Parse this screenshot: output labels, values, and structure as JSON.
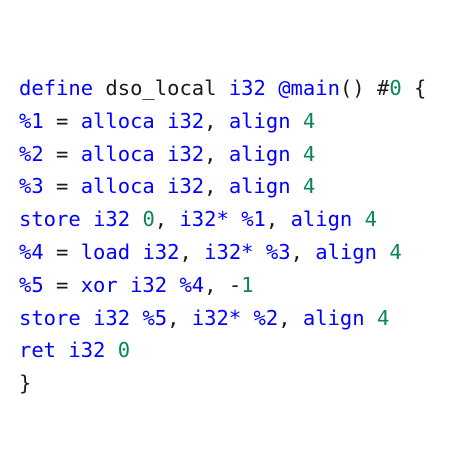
{
  "editor": {
    "colors": {
      "keyword": "#0000ff",
      "text": "#1a1a1a",
      "number": "#098658",
      "background": "#ffffff"
    },
    "lines": [
      [
        {
          "t": "define",
          "c": "keyword"
        },
        {
          "t": " ",
          "c": "plain"
        },
        {
          "t": "dso_local",
          "c": "plain"
        },
        {
          "t": " ",
          "c": "plain"
        },
        {
          "t": "i32",
          "c": "keyword"
        },
        {
          "t": " ",
          "c": "plain"
        },
        {
          "t": "@main",
          "c": "keyword"
        },
        {
          "t": "() ",
          "c": "punct"
        },
        {
          "t": "#",
          "c": "plain"
        },
        {
          "t": "0",
          "c": "number"
        },
        {
          "t": " {",
          "c": "punct"
        }
      ],
      [
        {
          "t": "%1",
          "c": "keyword"
        },
        {
          "t": " = ",
          "c": "plain"
        },
        {
          "t": "alloca",
          "c": "keyword"
        },
        {
          "t": " ",
          "c": "plain"
        },
        {
          "t": "i32",
          "c": "keyword"
        },
        {
          "t": ", ",
          "c": "punct"
        },
        {
          "t": "align",
          "c": "keyword"
        },
        {
          "t": " ",
          "c": "plain"
        },
        {
          "t": "4",
          "c": "number"
        }
      ],
      [
        {
          "t": "%2",
          "c": "keyword"
        },
        {
          "t": " = ",
          "c": "plain"
        },
        {
          "t": "alloca",
          "c": "keyword"
        },
        {
          "t": " ",
          "c": "plain"
        },
        {
          "t": "i32",
          "c": "keyword"
        },
        {
          "t": ", ",
          "c": "punct"
        },
        {
          "t": "align",
          "c": "keyword"
        },
        {
          "t": " ",
          "c": "plain"
        },
        {
          "t": "4",
          "c": "number"
        }
      ],
      [
        {
          "t": "%3",
          "c": "keyword"
        },
        {
          "t": " = ",
          "c": "plain"
        },
        {
          "t": "alloca",
          "c": "keyword"
        },
        {
          "t": " ",
          "c": "plain"
        },
        {
          "t": "i32",
          "c": "keyword"
        },
        {
          "t": ", ",
          "c": "punct"
        },
        {
          "t": "align",
          "c": "keyword"
        },
        {
          "t": " ",
          "c": "plain"
        },
        {
          "t": "4",
          "c": "number"
        }
      ],
      [
        {
          "t": "store",
          "c": "keyword"
        },
        {
          "t": " ",
          "c": "plain"
        },
        {
          "t": "i32",
          "c": "keyword"
        },
        {
          "t": " ",
          "c": "plain"
        },
        {
          "t": "0",
          "c": "number"
        },
        {
          "t": ", ",
          "c": "punct"
        },
        {
          "t": "i32*",
          "c": "keyword"
        },
        {
          "t": " ",
          "c": "plain"
        },
        {
          "t": "%1",
          "c": "keyword"
        },
        {
          "t": ", ",
          "c": "punct"
        },
        {
          "t": "align",
          "c": "keyword"
        },
        {
          "t": " ",
          "c": "plain"
        },
        {
          "t": "4",
          "c": "number"
        }
      ],
      [
        {
          "t": "%4",
          "c": "keyword"
        },
        {
          "t": " = ",
          "c": "plain"
        },
        {
          "t": "load",
          "c": "keyword"
        },
        {
          "t": " ",
          "c": "plain"
        },
        {
          "t": "i32",
          "c": "keyword"
        },
        {
          "t": ", ",
          "c": "punct"
        },
        {
          "t": "i32*",
          "c": "keyword"
        },
        {
          "t": " ",
          "c": "plain"
        },
        {
          "t": "%3",
          "c": "keyword"
        },
        {
          "t": ", ",
          "c": "punct"
        },
        {
          "t": "align",
          "c": "keyword"
        },
        {
          "t": " ",
          "c": "plain"
        },
        {
          "t": "4",
          "c": "number"
        }
      ],
      [
        {
          "t": "%5",
          "c": "keyword"
        },
        {
          "t": " = ",
          "c": "plain"
        },
        {
          "t": "xor",
          "c": "keyword"
        },
        {
          "t": " ",
          "c": "plain"
        },
        {
          "t": "i32",
          "c": "keyword"
        },
        {
          "t": " ",
          "c": "plain"
        },
        {
          "t": "%4",
          "c": "keyword"
        },
        {
          "t": ", ",
          "c": "punct"
        },
        {
          "t": "-",
          "c": "plain"
        },
        {
          "t": "1",
          "c": "number"
        }
      ],
      [
        {
          "t": "store",
          "c": "keyword"
        },
        {
          "t": " ",
          "c": "plain"
        },
        {
          "t": "i32",
          "c": "keyword"
        },
        {
          "t": " ",
          "c": "plain"
        },
        {
          "t": "%5",
          "c": "keyword"
        },
        {
          "t": ", ",
          "c": "punct"
        },
        {
          "t": "i32*",
          "c": "keyword"
        },
        {
          "t": " ",
          "c": "plain"
        },
        {
          "t": "%2",
          "c": "keyword"
        },
        {
          "t": ", ",
          "c": "punct"
        },
        {
          "t": "align",
          "c": "keyword"
        },
        {
          "t": " ",
          "c": "plain"
        },
        {
          "t": "4",
          "c": "number"
        }
      ],
      [
        {
          "t": "ret",
          "c": "keyword"
        },
        {
          "t": " ",
          "c": "plain"
        },
        {
          "t": "i32",
          "c": "keyword"
        },
        {
          "t": " ",
          "c": "plain"
        },
        {
          "t": "0",
          "c": "number"
        }
      ],
      [
        {
          "t": "}",
          "c": "punct"
        }
      ]
    ]
  }
}
